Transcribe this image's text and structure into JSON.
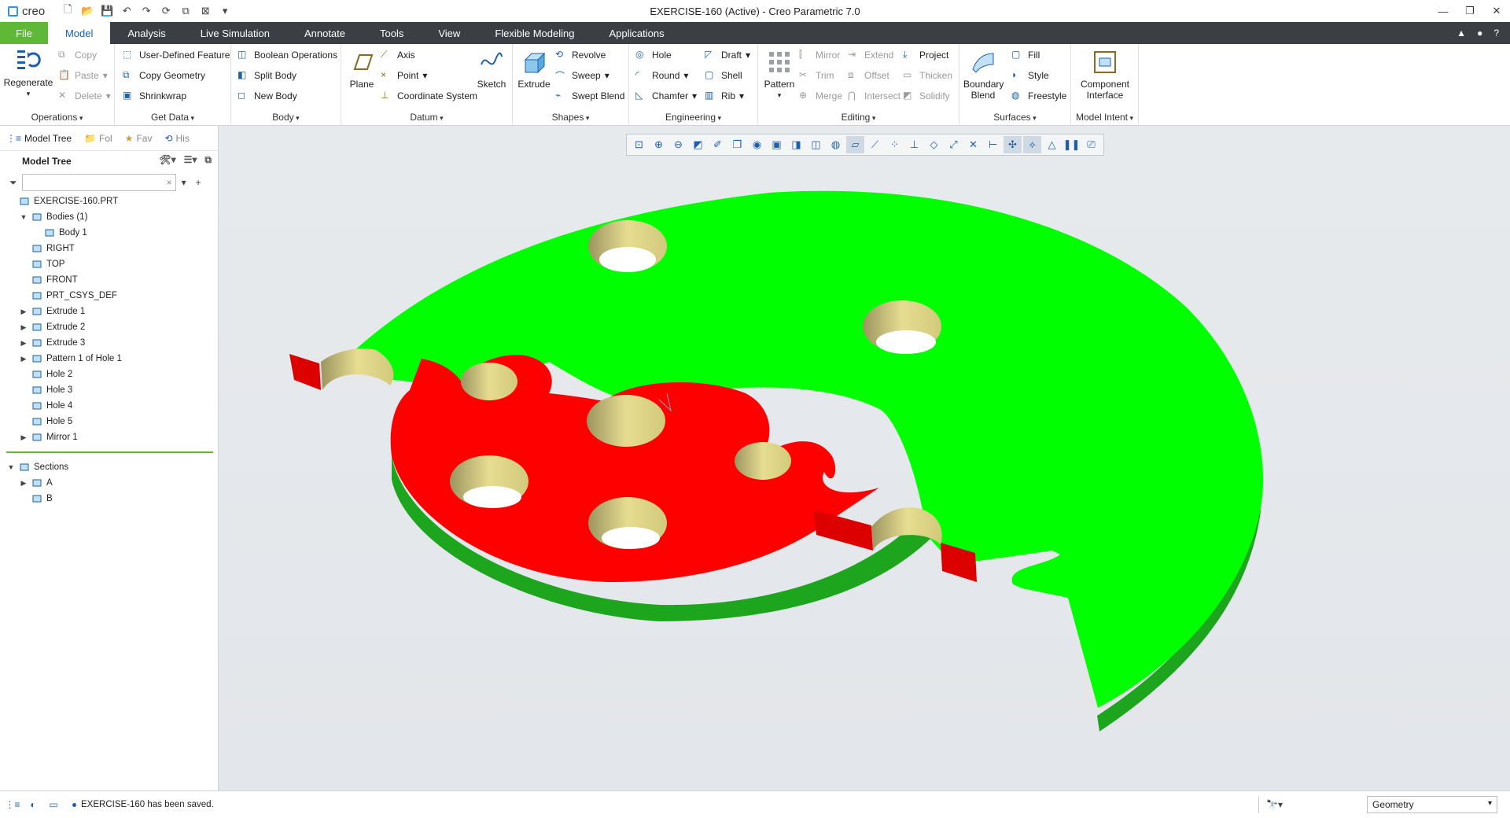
{
  "app": {
    "logo": "creo",
    "window_title": "EXERCISE-160 (Active) - Creo Parametric 7.0",
    "window_controls": [
      "—",
      "❐",
      "✕"
    ]
  },
  "tabs": [
    {
      "label": "File"
    },
    {
      "label": "Model"
    },
    {
      "label": "Analysis"
    },
    {
      "label": "Live Simulation"
    },
    {
      "label": "Annotate"
    },
    {
      "label": "Tools"
    },
    {
      "label": "View"
    },
    {
      "label": "Flexible Modeling"
    },
    {
      "label": "Applications"
    }
  ],
  "ribbon": {
    "operations": {
      "label": "Operations",
      "regenerate": "Regenerate",
      "copy": "Copy",
      "paste": "Paste",
      "delete": "Delete"
    },
    "get_data": {
      "label": "Get Data",
      "udf": "User-Defined Feature",
      "copy_geometry": "Copy Geometry",
      "shrinkwrap": "Shrinkwrap"
    },
    "body": {
      "label": "Body",
      "boolean": "Boolean Operations",
      "split": "Split Body",
      "new": "New Body"
    },
    "datum": {
      "label": "Datum",
      "plane": "Plane",
      "axis": "Axis",
      "point": "Point",
      "csys": "Coordinate System",
      "sketch": "Sketch"
    },
    "shapes": {
      "label": "Shapes",
      "extrude": "Extrude",
      "revolve": "Revolve",
      "sweep": "Sweep",
      "swept_blend": "Swept Blend"
    },
    "engineering": {
      "label": "Engineering",
      "hole": "Hole",
      "round": "Round",
      "chamfer": "Chamfer",
      "draft": "Draft",
      "shell": "Shell",
      "rib": "Rib"
    },
    "editing": {
      "label": "Editing",
      "pattern": "Pattern",
      "mirror": "Mirror",
      "trim": "Trim",
      "merge": "Merge",
      "extend": "Extend",
      "offset": "Offset",
      "intersect": "Intersect",
      "project": "Project",
      "thicken": "Thicken",
      "solidify": "Solidify"
    },
    "surfaces": {
      "label": "Surfaces",
      "boundary_blend": "Boundary Blend",
      "fill": "Fill",
      "style": "Style",
      "freestyle": "Freestyle"
    },
    "model_intent": {
      "label": "Model Intent",
      "component_interface": "Component Interface"
    }
  },
  "panel": {
    "tabs": [
      {
        "label": "Model Tree"
      },
      {
        "label": "Fol"
      },
      {
        "label": "Fav"
      },
      {
        "label": "His"
      }
    ],
    "tree_title": "Model Tree",
    "search_placeholder": "",
    "tree": [
      {
        "label": "EXERCISE-160.PRT",
        "indent": 0,
        "expander": "",
        "icon": "part-icon"
      },
      {
        "label": "Bodies (1)",
        "indent": 1,
        "expander": "▼",
        "icon": "bodies-icon"
      },
      {
        "label": "Body 1",
        "indent": 2,
        "expander": "",
        "icon": "body-icon"
      },
      {
        "label": "RIGHT",
        "indent": 1,
        "expander": "",
        "icon": "datum-plane-icon"
      },
      {
        "label": "TOP",
        "indent": 1,
        "expander": "",
        "icon": "datum-plane-icon"
      },
      {
        "label": "FRONT",
        "indent": 1,
        "expander": "",
        "icon": "datum-plane-icon"
      },
      {
        "label": "PRT_CSYS_DEF",
        "indent": 1,
        "expander": "",
        "icon": "csys-icon"
      },
      {
        "label": "Extrude 1",
        "indent": 1,
        "expander": "▶",
        "icon": "extrude-icon"
      },
      {
        "label": "Extrude 2",
        "indent": 1,
        "expander": "▶",
        "icon": "extrude-icon"
      },
      {
        "label": "Extrude 3",
        "indent": 1,
        "expander": "▶",
        "icon": "extrude-icon"
      },
      {
        "label": "Pattern 1 of Hole 1",
        "indent": 1,
        "expander": "▶",
        "icon": "pattern-icon"
      },
      {
        "label": "Hole 2",
        "indent": 1,
        "expander": "",
        "icon": "hole-icon"
      },
      {
        "label": "Hole 3",
        "indent": 1,
        "expander": "",
        "icon": "hole-icon"
      },
      {
        "label": "Hole 4",
        "indent": 1,
        "expander": "",
        "icon": "hole-icon"
      },
      {
        "label": "Hole 5",
        "indent": 1,
        "expander": "",
        "icon": "hole-icon"
      },
      {
        "label": "Mirror 1",
        "indent": 1,
        "expander": "▶",
        "icon": "mirror-icon"
      }
    ],
    "sections": [
      {
        "label": "Sections",
        "indent": 0,
        "expander": "▼",
        "icon": "sections-icon"
      },
      {
        "label": "A",
        "indent": 1,
        "expander": "▶",
        "icon": "section-icon"
      },
      {
        "label": "B",
        "indent": 1,
        "expander": "",
        "icon": "section-icon"
      }
    ]
  },
  "status": {
    "message": "EXERCISE-160 has been saved.",
    "filter_value": "Geometry"
  },
  "colors": {
    "accent": "#5fb936",
    "tab_bar": "#3b3f44",
    "cut_section": "#ff0000",
    "part_surface": "#00ff00",
    "hole_wall": "#e2d98a"
  }
}
